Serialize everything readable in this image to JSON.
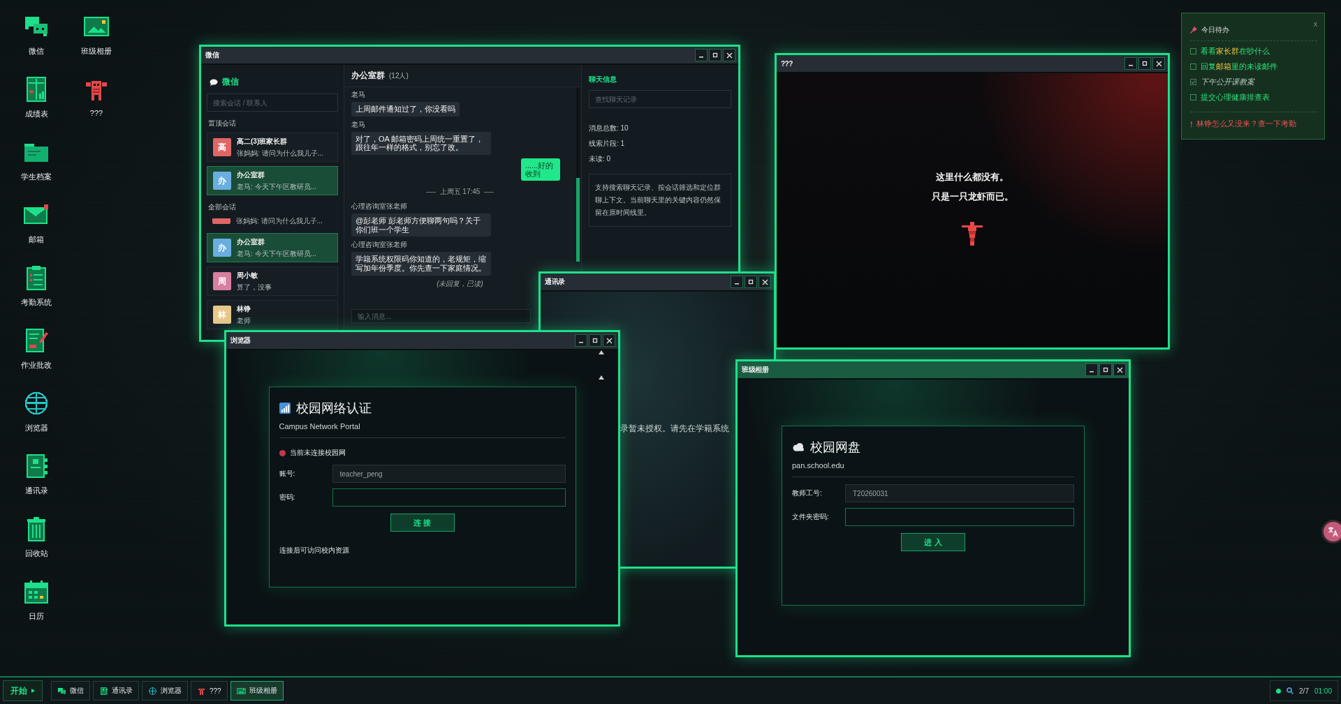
{
  "desktop": {
    "columns": [
      [
        {
          "label": "微信",
          "kind": "chat"
        },
        {
          "label": "成绩表",
          "kind": "sheet"
        },
        {
          "label": "学生档案",
          "kind": "folder"
        },
        {
          "label": "邮箱",
          "kind": "mail"
        },
        {
          "label": "考勤系统",
          "kind": "clipboard"
        },
        {
          "label": "作业批改",
          "kind": "grading"
        },
        {
          "label": "浏览器",
          "kind": "globe"
        },
        {
          "label": "通讯录",
          "kind": "contacts"
        },
        {
          "label": "回收站",
          "kind": "trash"
        },
        {
          "label": "日历",
          "kind": "calendar"
        }
      ],
      [
        {
          "label": "班级相册",
          "kind": "photo"
        },
        {
          "label": "???",
          "kind": "monster"
        }
      ]
    ]
  },
  "chat_window": {
    "title": "微信",
    "active": false,
    "sidebar": {
      "app_name": "微信",
      "search_placeholder": "搜索会话 / 联系人",
      "pinned_heading": "置顶会话",
      "pinned": [
        {
          "avatar": "高",
          "color": "#e06666",
          "name": "高二(3)班家长群",
          "preview": "张妈妈: 请问为什么我儿子...",
          "selected": false
        },
        {
          "avatar": "办",
          "color": "#6aaee0",
          "name": "办公室群",
          "preview": "老马: 今天下午区教研员...",
          "selected": true
        }
      ],
      "all_heading": "全部会话",
      "all": [
        {
          "color": "#e06666",
          "preview": "张妈妈: 请问为什么我儿子..."
        },
        {
          "avatar": "办",
          "color": "#6aaee0",
          "name": "办公室群",
          "preview": "老马: 今天下午区教研员...",
          "selected": true
        },
        {
          "avatar": "周",
          "color": "#d77fa1",
          "name": "周小敏",
          "preview": "算了，没事",
          "selected": false
        },
        {
          "avatar": "林",
          "color": "#e8c88a",
          "name": "林铮",
          "preview": "老师",
          "selected": false
        }
      ]
    },
    "conversation": {
      "group_name": "办公室群",
      "member_count": "(12人)",
      "messages": [
        {
          "kind": "incoming",
          "sender": "老马",
          "text": "上周邮件通知过了，你没看吗"
        },
        {
          "kind": "incoming",
          "sender": "老马",
          "text": "对了，OA 邮箱密码上周统一重置了，跟往年一样的格式，别忘了改。"
        },
        {
          "kind": "outgoing",
          "text": "......好的收到"
        },
        {
          "kind": "divider",
          "text": "上周五 17:45"
        },
        {
          "kind": "incoming",
          "sender": "心理咨询室张老师",
          "text": "@彭老师 彭老师方便聊两句吗？关于你们班一个学生"
        },
        {
          "kind": "incoming",
          "sender": "心理咨询室张老师",
          "text": "学籍系统权限码你知道的，老规矩，缩写加年份季度。你先查一下家庭情况。"
        },
        {
          "kind": "status",
          "text": "(未回复，已读)"
        }
      ],
      "input_placeholder": "输入消息..."
    },
    "info": {
      "heading": "聊天信息",
      "search_placeholder": "查找聊天记录",
      "stats": [
        "消息总数: 10",
        "线索片段: 1",
        "未读: 0"
      ],
      "note": "支持搜索聊天记录、按会话筛选和定位群聊上下文。当前聊天里的关键内容仍然保留在原时间线里。"
    }
  },
  "contacts_window": {
    "title": "通讯录",
    "active": false,
    "message": "录暂未授权。请先在学籍系统"
  },
  "mystery_window": {
    "title": "???",
    "active": false,
    "lines": [
      "这里什么都没有。",
      "只是一只龙虾而已。"
    ]
  },
  "browser_window": {
    "title": "浏览器",
    "active": false,
    "portal": {
      "title": "校园网络认证",
      "subtitle": "Campus Network Portal",
      "status": {
        "text": "当前未连接校园网",
        "connected": false
      },
      "fields": [
        {
          "label": "账号:",
          "value": "teacher_peng",
          "readonly": true
        },
        {
          "label": "密码:",
          "readonly": false
        }
      ],
      "button": "连 接",
      "footer": "连接后可访问校内资源"
    }
  },
  "netdisk_window": {
    "title": "班级相册",
    "active": true,
    "portal": {
      "title": "校园网盘",
      "subtitle": "pan.school.edu",
      "fields": [
        {
          "label": "教师工号:",
          "value": "T20260031",
          "readonly": true
        },
        {
          "label": "文件夹密码:",
          "readonly": false
        }
      ],
      "button": "进 入"
    }
  },
  "todo": {
    "title": "今日待办",
    "close": "x",
    "items": [
      {
        "checked": false,
        "parts": [
          {
            "text": "看看",
            "highlight": false
          },
          {
            "text": "家长群",
            "highlight": true
          },
          {
            "text": "在吵什么",
            "highlight": false
          }
        ]
      },
      {
        "checked": false,
        "parts": [
          {
            "text": "回复",
            "highlight": false
          },
          {
            "text": "邮箱",
            "highlight": true
          },
          {
            "text": "里的未读邮件",
            "highlight": false
          }
        ]
      },
      {
        "checked": true,
        "parts": [
          {
            "text": "下午公开课教案",
            "highlight": false
          }
        ]
      },
      {
        "checked": false,
        "parts": [
          {
            "text": "提交心理健康排查表",
            "highlight": false
          }
        ]
      }
    ],
    "alert": {
      "mark": "!",
      "text": "林铮怎么又没来？查一下考勤"
    }
  },
  "taskbar": {
    "start": "开始",
    "items": [
      {
        "label": "微信",
        "kind": "chat",
        "selected": false
      },
      {
        "label": "通讯录",
        "kind": "contacts",
        "selected": false
      },
      {
        "label": "浏览器",
        "kind": "globe",
        "selected": false
      },
      {
        "label": "???",
        "kind": "monster",
        "selected": false
      },
      {
        "label": "班级相册",
        "kind": "photo",
        "selected": true
      }
    ],
    "tray": {
      "online": true,
      "page": "2/7",
      "time": "01:00"
    }
  }
}
